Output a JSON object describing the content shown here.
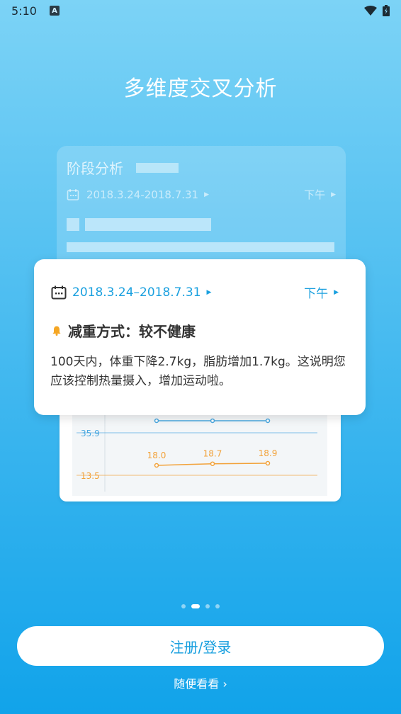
{
  "status_bar": {
    "time": "5:10",
    "notification_letter": "A"
  },
  "hero": {
    "title": "多维度交叉分析"
  },
  "back_card": {
    "title": "阶段分析",
    "date_range": "2018.3.24-2018.7.31",
    "period": "下午"
  },
  "front_card": {
    "date_range": "2018.3.24–2018.7.31",
    "period": "下午",
    "warning_title": "减重方式：较不健康",
    "description": "100天内，体重下降2.7kg，脂肪增加1.7kg。这说明您应该控制热量摄入，增加运动啦。"
  },
  "chart_data": {
    "type": "line",
    "y_reference_lines": [
      35.9,
      13.5
    ],
    "series": [
      {
        "values": [
          null,
          null,
          null
        ],
        "color": "#4aa8e0"
      },
      {
        "values": [
          18.0,
          18.7,
          18.9
        ],
        "color": "#f2a23a"
      }
    ],
    "tick_labels": [
      "35.9",
      "13.5"
    ],
    "data_labels": [
      "18.0",
      "18.7",
      "18.9"
    ],
    "colors": {
      "blue": "#4aa8e0",
      "orange": "#f2a23a"
    }
  },
  "pager": {
    "count": 4,
    "active": 1
  },
  "actions": {
    "login_label": "注册/登录",
    "browse_label": "随便看看 ›"
  },
  "colors": {
    "accent": "#1aa0df",
    "warning": "#f5a623"
  }
}
